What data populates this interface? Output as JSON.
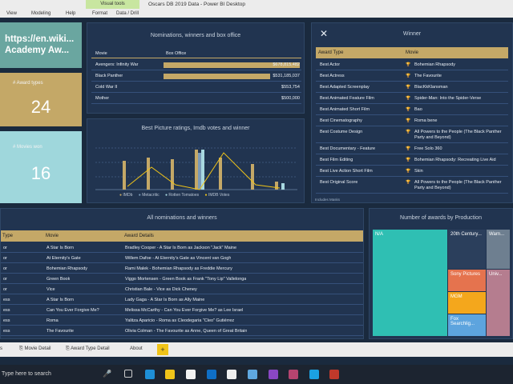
{
  "window": {
    "menu": [
      "View",
      "Modeling",
      "Help",
      "Format",
      "Data / Drill"
    ],
    "visual_tools_label": "Visual tools",
    "title": "Oscars DB 2019 Data - Power BI Desktop"
  },
  "cards": {
    "url_text": "https://en.wiki... Academy Aw...",
    "award_types_label": "# Award types",
    "award_types_value": "24",
    "movies_won_label": "# Movies won",
    "movies_won_value": "16"
  },
  "box_office": {
    "title": "Nominations, winners and box office",
    "headers": [
      "Movie",
      "Box Office"
    ],
    "rows": [
      {
        "movie": "Avengers: Infinity War",
        "value": "$678,815,482",
        "fraction": 1.0
      },
      {
        "movie": "Black Panther",
        "value": "$531,185,037",
        "fraction": 0.78
      },
      {
        "movie": "Cold War II",
        "value": "$553,754",
        "fraction": 0.0
      },
      {
        "movie": "Mother",
        "value": "$500,000",
        "fraction": 0.0
      }
    ]
  },
  "ratings": {
    "title": "Best Picture ratings, Imdb votes and winner",
    "legend": [
      "IMDb",
      "Metacritic",
      "Rotten Tomatoes",
      "IMDB Votes"
    ]
  },
  "winner": {
    "title": "Winner",
    "headers": [
      "Award Type",
      "Movie"
    ],
    "rows": [
      {
        "award": "Best Actor",
        "movie": "Bohemian Rhapsody"
      },
      {
        "award": "Best Actress",
        "movie": "The Favourite"
      },
      {
        "award": "Best Adapted Screenplay",
        "movie": "BlacKkKlansman"
      },
      {
        "award": "Best Animated Feature Film",
        "movie": "Spider-Man: Into the Spider-Verse"
      },
      {
        "award": "Best Animated Short Film",
        "movie": "Bao"
      },
      {
        "award": "Best Cinematography",
        "movie": "Roma bene"
      },
      {
        "award": "Best Costume Design",
        "movie": "All Powers to the People (The Black Panther Party and Beyond)"
      },
      {
        "award": "Best Documentary - Feature",
        "movie": "Free Solo 360"
      },
      {
        "award": "Best Film Editing",
        "movie": "Bohemian Rhapsody: Recreating Live Aid"
      },
      {
        "award": "Best Live Action Short Film",
        "movie": "Skin"
      },
      {
        "award": "Best Original Score",
        "movie": "All Powers to the People (The Black Panther Party and Beyond)"
      }
    ],
    "footer": "Includes Masks"
  },
  "nominations": {
    "title": "All nominations and winners",
    "headers": [
      "Type",
      "Movie",
      "Award Details"
    ],
    "rows": [
      {
        "type": "or",
        "movie": "A Star Is Born",
        "details": "Bradley Cooper - A Star Is Born as Jackson \"Jack\" Maine"
      },
      {
        "type": "or",
        "movie": "At Eternity's Gate",
        "details": "Willem Dafoe - At Eternity's Gate as Vincent van Gogh"
      },
      {
        "type": "or",
        "movie": "Bohemian Rhapsody",
        "details": "Rami Malek - Bohemian Rhapsody as Freddie Mercury"
      },
      {
        "type": "or",
        "movie": "Green Book",
        "details": "Viggo Mortensen - Green Book as Frank \"Tony Lip\" Vallelonga"
      },
      {
        "type": "or",
        "movie": "Vice",
        "details": "Christian Bale - Vice as Dick Cheney"
      },
      {
        "type": "ess",
        "movie": "A Star Is Born",
        "details": "Lady Gaga - A Star Is Born as Ally Maine"
      },
      {
        "type": "ess",
        "movie": "Can You Ever Forgive Me?",
        "details": "Melissa McCarthy - Can You Ever Forgive Me? as Lee Israel"
      },
      {
        "type": "ess",
        "movie": "Roma",
        "details": "Yalitza Aparicio - Roma as Cleodegaria \"Cleo\" Gutiérrez"
      },
      {
        "type": "ess",
        "movie": "The Favourite",
        "details": "Olivia Colman - The Favourite as Anne, Queen of Great Britain"
      }
    ]
  },
  "treemap": {
    "title": "Number of awards by Production",
    "tiles": [
      "N/A",
      "20th Century...",
      "Warn...",
      "Sony Pictures",
      "Univ...",
      "MGM",
      "Fox Searchlig..."
    ],
    "colors": [
      "#2fbfb3",
      "#2b3f5c",
      "#6e7f90",
      "#e5734e",
      "#b57d8f",
      "#f4a71c",
      "#5da4de"
    ]
  },
  "tabs": [
    "Movie Detail",
    "Award Type Detail",
    "About"
  ],
  "search_placeholder": "Type here to search"
}
